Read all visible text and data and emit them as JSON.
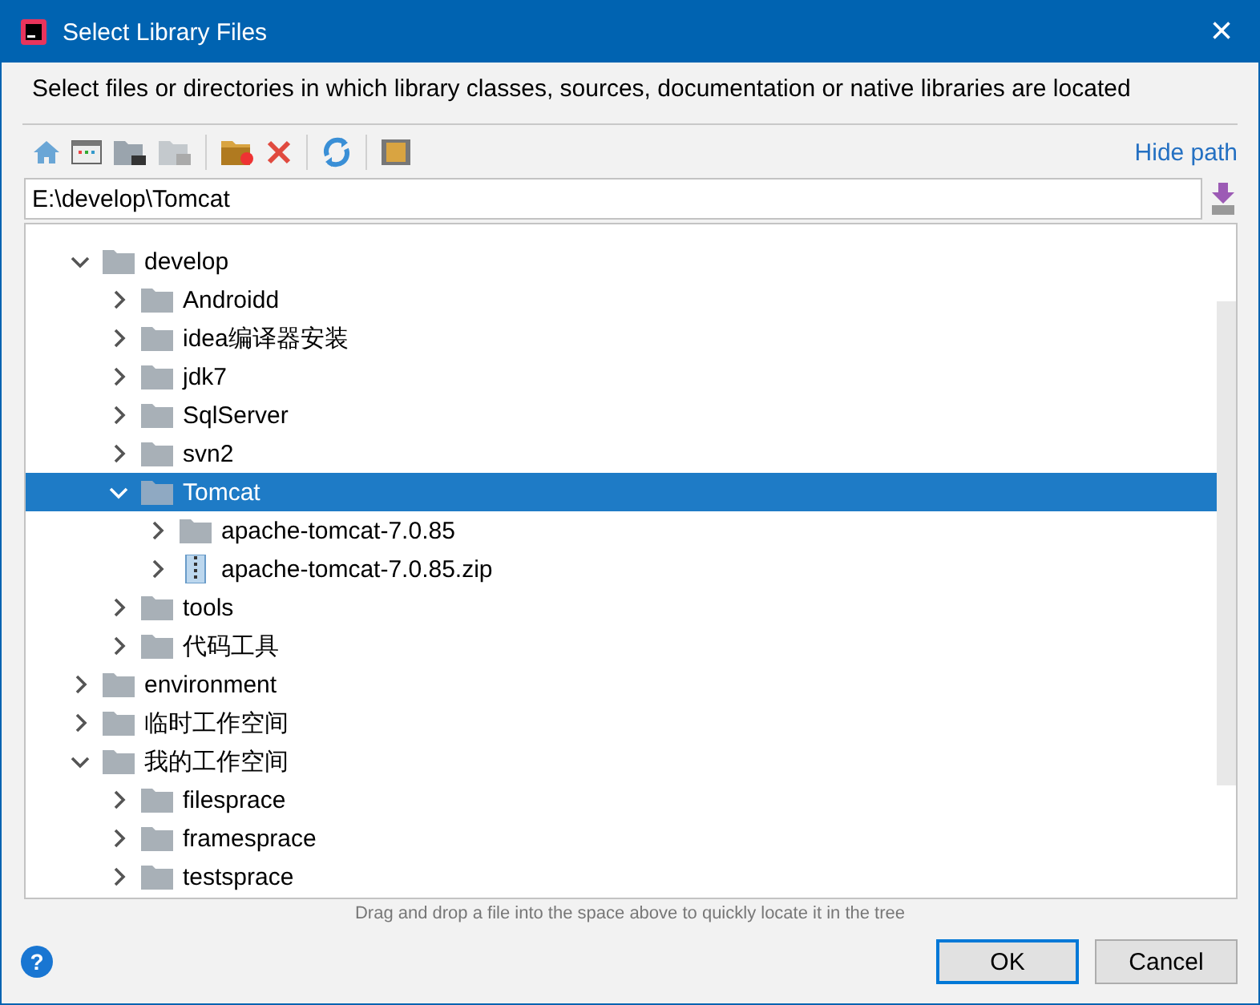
{
  "window": {
    "title": "Select Library Files",
    "close_label": "×"
  },
  "description": "Select files or directories in which library classes, sources, documentation or native libraries are located",
  "hide_path_link": "Hide path",
  "path_field": {
    "value": "E:\\develop\\Tomcat"
  },
  "tree": [
    {
      "label": "develop",
      "kind": "folder",
      "expanded": true,
      "selected": false,
      "children": [
        {
          "label": "Androidd",
          "kind": "folder",
          "expanded": false,
          "selected": false
        },
        {
          "label": "idea编译器安装",
          "kind": "folder",
          "expanded": false,
          "selected": false
        },
        {
          "label": "jdk7",
          "kind": "folder",
          "expanded": false,
          "selected": false
        },
        {
          "label": "SqlServer",
          "kind": "folder",
          "expanded": false,
          "selected": false
        },
        {
          "label": "svn2",
          "kind": "folder",
          "expanded": false,
          "selected": false
        },
        {
          "label": "Tomcat",
          "kind": "folder",
          "expanded": true,
          "selected": true,
          "children": [
            {
              "label": "apache-tomcat-7.0.85",
              "kind": "folder",
              "expanded": false,
              "selected": false
            },
            {
              "label": "apache-tomcat-7.0.85.zip",
              "kind": "zip",
              "expanded": false,
              "selected": false
            }
          ]
        },
        {
          "label": "tools",
          "kind": "folder",
          "expanded": false,
          "selected": false
        },
        {
          "label": "代码工具",
          "kind": "folder",
          "expanded": false,
          "selected": false
        }
      ]
    },
    {
      "label": "environment",
      "kind": "folder",
      "expanded": false,
      "selected": false
    },
    {
      "label": "临时工作空间",
      "kind": "folder",
      "expanded": false,
      "selected": false
    },
    {
      "label": "我的工作空间",
      "kind": "folder",
      "expanded": true,
      "selected": false,
      "children": [
        {
          "label": "filesprace",
          "kind": "folder",
          "expanded": false,
          "selected": false
        },
        {
          "label": "framesprace",
          "kind": "folder",
          "expanded": false,
          "selected": false
        },
        {
          "label": "testsprace",
          "kind": "folder",
          "expanded": false,
          "selected": false
        }
      ]
    }
  ],
  "hint": "Drag and drop a file into the space above to quickly locate it in the tree",
  "help_label": "?",
  "buttons": [
    {
      "label": "OK",
      "default": true
    },
    {
      "label": "Cancel",
      "default": false
    }
  ]
}
